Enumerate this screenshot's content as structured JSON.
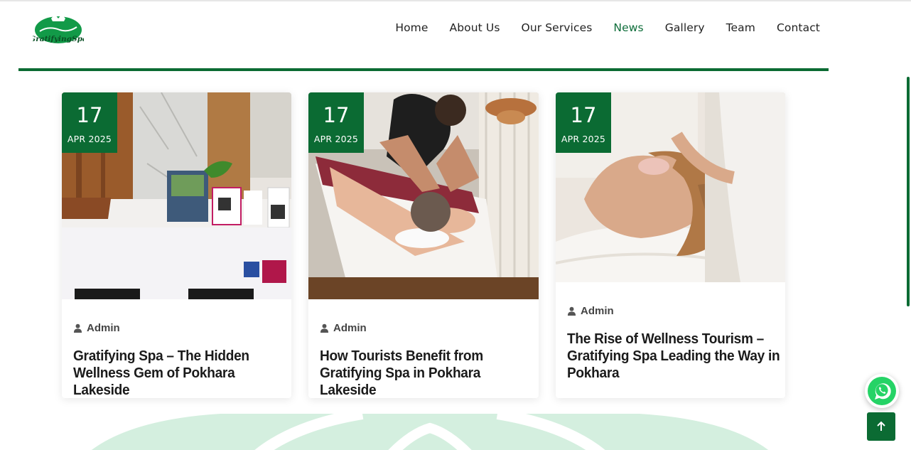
{
  "brand": {
    "logo_text": "GratifyingSpa",
    "accent": "#0b6b33"
  },
  "nav": {
    "items": [
      {
        "label": "Home",
        "active": false
      },
      {
        "label": "About Us",
        "active": false
      },
      {
        "label": "Our Services",
        "active": false
      },
      {
        "label": "News",
        "active": true
      },
      {
        "label": "Gallery",
        "active": false
      },
      {
        "label": "Team",
        "active": false
      },
      {
        "label": "Contact",
        "active": false
      }
    ]
  },
  "posts": [
    {
      "day": "17",
      "month": "APR 2025",
      "author": "Admin",
      "title": "Gratifying Spa – The Hidden Wellness Gem of Pokhara Lakeside"
    },
    {
      "day": "17",
      "month": "APR 2025",
      "author": "Admin",
      "title": "How Tourists Benefit from Gratifying Spa in Pokhara Lakeside"
    },
    {
      "day": "17",
      "month": "APR 2025",
      "author": "Admin",
      "title": "The Rise of Wellness Tourism – Gratifying Spa Leading the Way in Pokhara"
    }
  ],
  "icons": {
    "author": "user-icon",
    "whatsapp": "whatsapp-icon",
    "scroll_top": "arrow-up-icon"
  }
}
